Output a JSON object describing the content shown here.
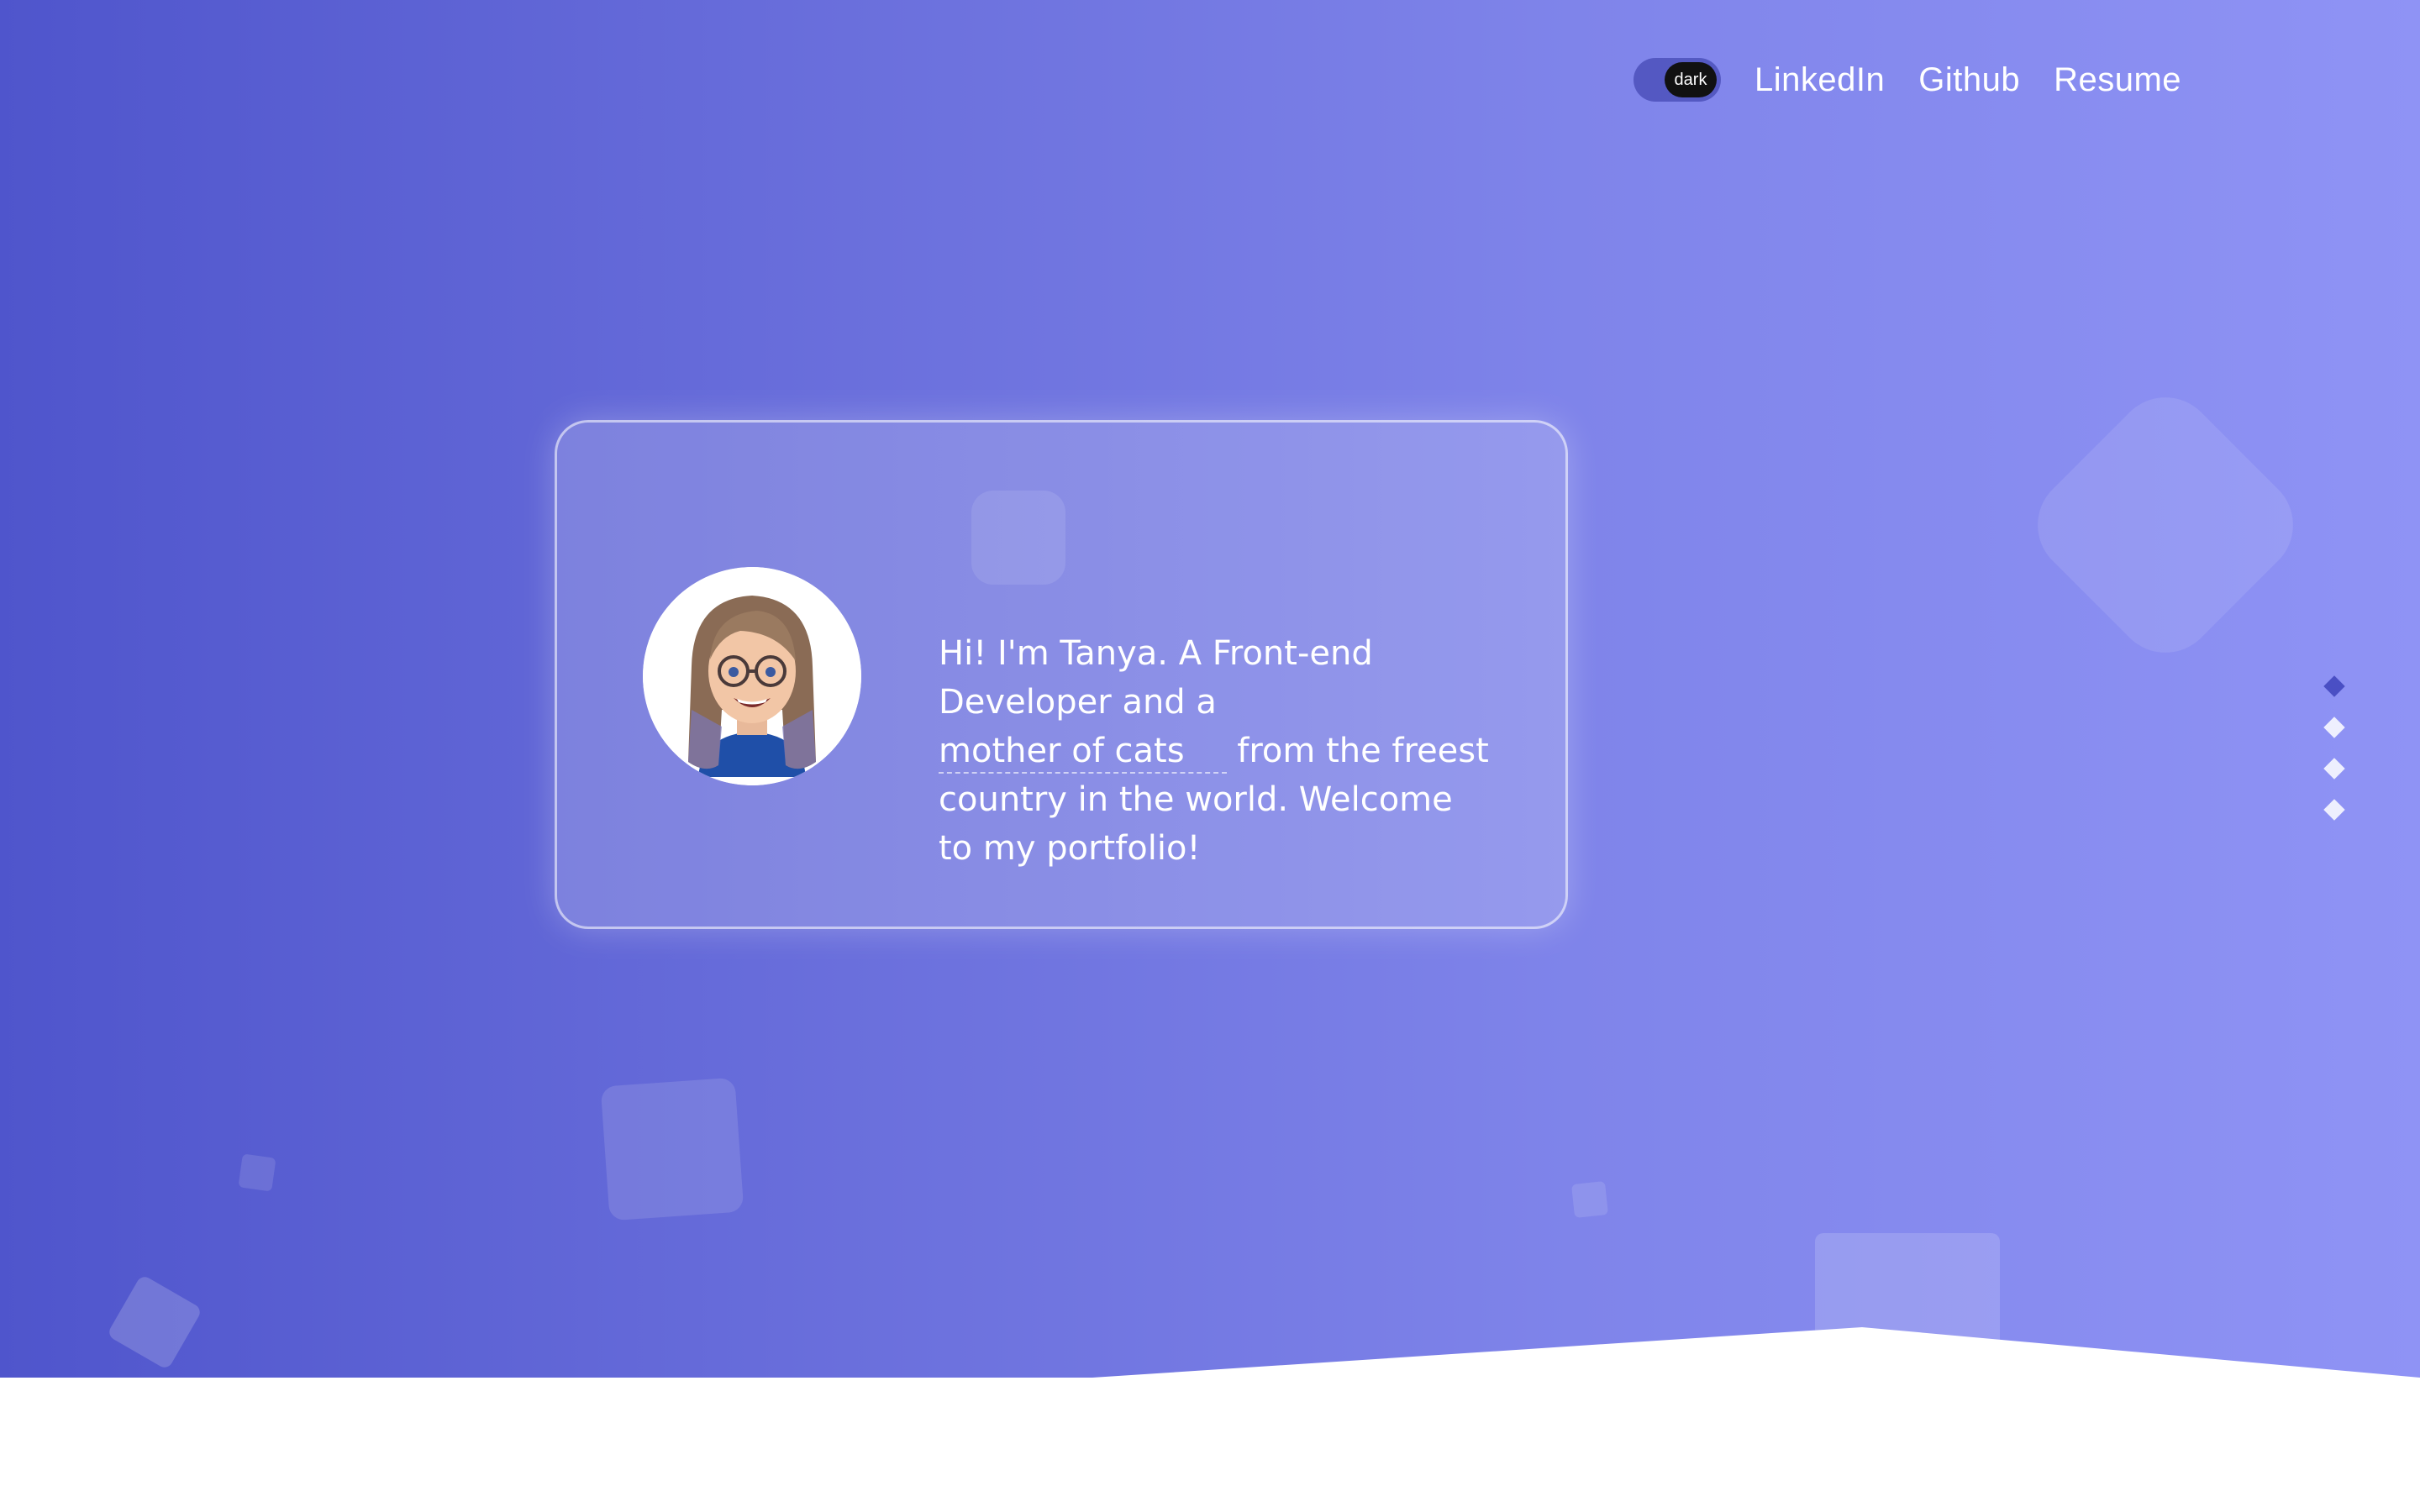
{
  "header": {
    "theme_toggle": {
      "label": "dark"
    },
    "links": [
      {
        "label": "LinkedIn"
      },
      {
        "label": "Github"
      },
      {
        "label": "Resume"
      }
    ]
  },
  "intro": {
    "text_before": "Hi! I'm Tanya. A Front-end Developer and a ",
    "highlight": "mother of cats",
    "text_after": " from the freest country in the world. Welcome to my portfolio!"
  },
  "section_nav": {
    "count": 4,
    "active_index": 0
  },
  "colors": {
    "gradient_start": "#4f55cc",
    "gradient_end": "#8f93f5",
    "active_dot": "#4a4fc4",
    "toggle_knob": "#111111"
  },
  "icons": {
    "avatar": "memoji-avatar",
    "section_dots": "diamond-icon"
  }
}
